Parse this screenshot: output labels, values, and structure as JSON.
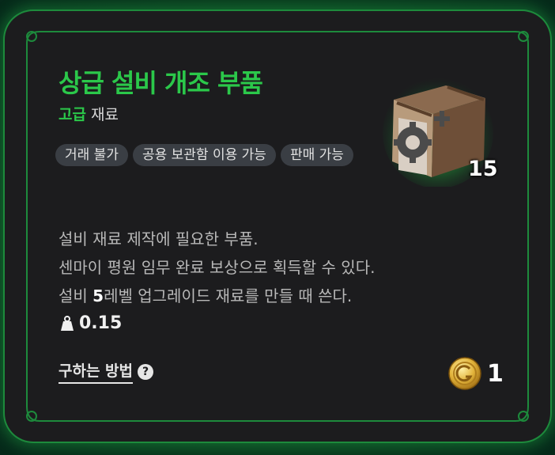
{
  "item": {
    "name": "상급 설비 개조 부품",
    "grade_label": "고급",
    "category": "재료",
    "quantity": "15",
    "tags": [
      "거래 불가",
      "공용 보관함 이용 가능",
      "판매 가능"
    ],
    "description": {
      "line1": "설비 재료 제작에 필요한 부품.",
      "line2": "센마이 평원 임무 완료 보상으로 획득할 수 있다.",
      "line3_prefix": "설비 ",
      "line3_bold": "5",
      "line3_suffix": "레벨 업그레이드 재료를 만들 때 쓴다."
    },
    "weight": "0.15",
    "weight_icon": "weight-icon",
    "how_to_obtain_label": "구하는 방법",
    "help_icon_glyph": "?",
    "price": "1",
    "price_icon": "gold-coin-icon"
  },
  "colors": {
    "accent": "#2bc84a",
    "card_bg": "#1c1c1e",
    "frame": "#1d8a3c"
  }
}
